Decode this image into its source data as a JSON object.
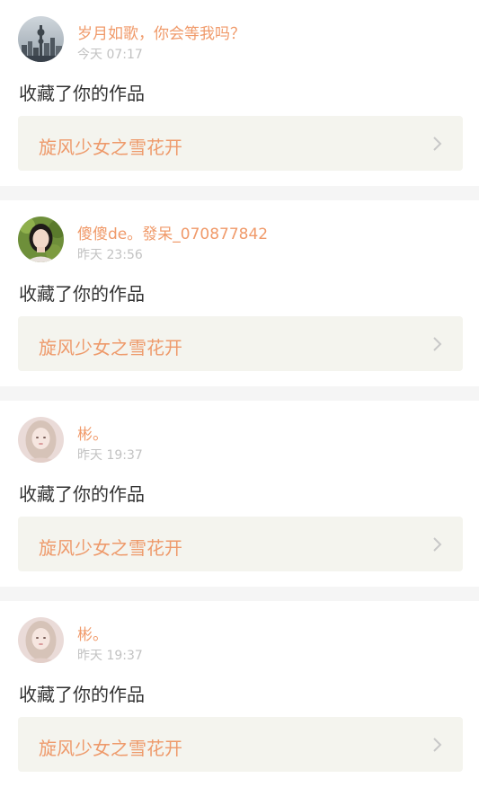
{
  "notifications": [
    {
      "avatar_icon": "city-skyline-avatar",
      "username": "岁月如歌，你会等我吗？",
      "time": "今天 07:17",
      "action": "收藏了你的作品",
      "work_title": "旋风少女之雪花开"
    },
    {
      "avatar_icon": "woman-portrait-avatar",
      "username": "傻傻de。發呆_070877842",
      "time": "昨天 23:56",
      "action": "收藏了你的作品",
      "work_title": "旋风少女之雪花开"
    },
    {
      "avatar_icon": "girl-portrait-avatar",
      "username": "彬。",
      "time": "昨天 19:37",
      "action": "收藏了你的作品",
      "work_title": "旋风少女之雪花开"
    },
    {
      "avatar_icon": "girl-portrait-avatar",
      "username": "彬。",
      "time": "昨天 19:37",
      "action": "收藏了你的作品",
      "work_title": "旋风少女之雪花开"
    }
  ],
  "colors": {
    "accent": "#ee9a6b",
    "username": "#f09a6a",
    "time": "#c2c2c2",
    "card_bg": "#f4f4ee",
    "separator": "#f5f5f5"
  }
}
